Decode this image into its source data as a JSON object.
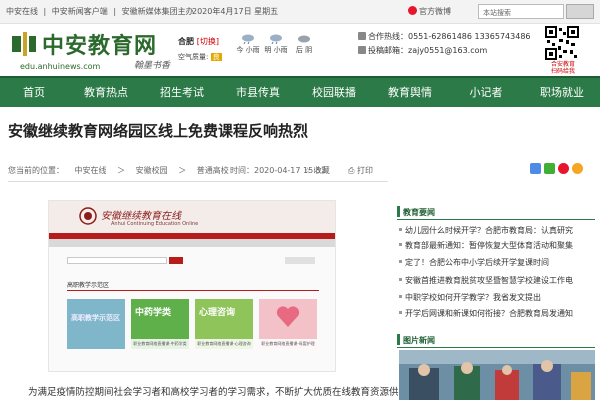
{
  "topbar": {
    "links": [
      "中安在线",
      "|",
      "中安新闻客户端",
      "|",
      "安徽新媒体集团主办"
    ],
    "date": "2020年4月17日 星期五",
    "weibo": "官方微博",
    "search_placeholder": "本站搜索"
  },
  "header": {
    "logo_name": "中安教育网",
    "logo_url": "edu.anhuinews.com",
    "logo_sig": "翰墨书香",
    "weather": {
      "city": "合肥",
      "switch": "[切换]",
      "aq_label": "空气质量:",
      "aq_value": "良",
      "days": [
        {
          "label": "今 小雨",
          "temp": "11~15℃"
        },
        {
          "label": "明 小雨",
          "temp": "10~16℃"
        },
        {
          "label": "后 阴",
          "temp": "11~19℃"
        }
      ]
    },
    "hotline": "合作热线：0551-62861486 13365743486",
    "email": "投稿邮箱：zajy0551@163.com",
    "qr_caption": [
      "合安教育",
      "扫码给我"
    ]
  },
  "nav": [
    "首页",
    "教育热点",
    "招生考试",
    "市县传真",
    "校园联播",
    "教育舆情",
    "小记者",
    "职场就业"
  ],
  "article": {
    "title": "安徽继续教育网络园区线上免费课程反响热烈",
    "crumbs": [
      "您当前的位置：",
      "中安在线",
      "＞",
      "安徽校园",
      "＞",
      "普通高校"
    ],
    "time": "时间：2020-04-17 15:53",
    "collect": "收藏",
    "print": "打印",
    "body_first_line": "为满足疫情防控期间社会学习者和高校学习者的学习需求，不断扩大优质在线教育资源供"
  },
  "embedded_site": {
    "title": "安徽继续教育在线",
    "subtitle": "Anhui Continuing Education Online",
    "section": "高职教学示范区",
    "tiles": [
      {
        "label": "高职教学示范区",
        "caption": ""
      },
      {
        "label": "中药学类",
        "caption": "职业教育网络直播课·中药学类"
      },
      {
        "label": "心理咨询",
        "caption": "职业教育网络直播课·心理咨询"
      },
      {
        "label": "",
        "caption": "职业教育网络直播课·母婴护理"
      }
    ]
  },
  "sidebar": {
    "news_title": "教育要闻",
    "news": [
      "幼儿园什么时候开学？合肥市教育局：认真研究",
      "教育部最新通知：暂停恢复大型体育活动和聚集",
      "定了！合肥公布中小学后续开学复课时间",
      "安徽首推进教育脱贫攻坚暨智慧学校建设工作电",
      "中职学校如何开学教学？我省发文提出",
      "开学后网课和新课如何衔接？合肥教育局发通知"
    ],
    "photo_title": "图片新闻"
  },
  "colors": {
    "nav_green": "#2c7a47",
    "logo_green": "#2b6a2c",
    "banner_red": "#b71c1c"
  }
}
